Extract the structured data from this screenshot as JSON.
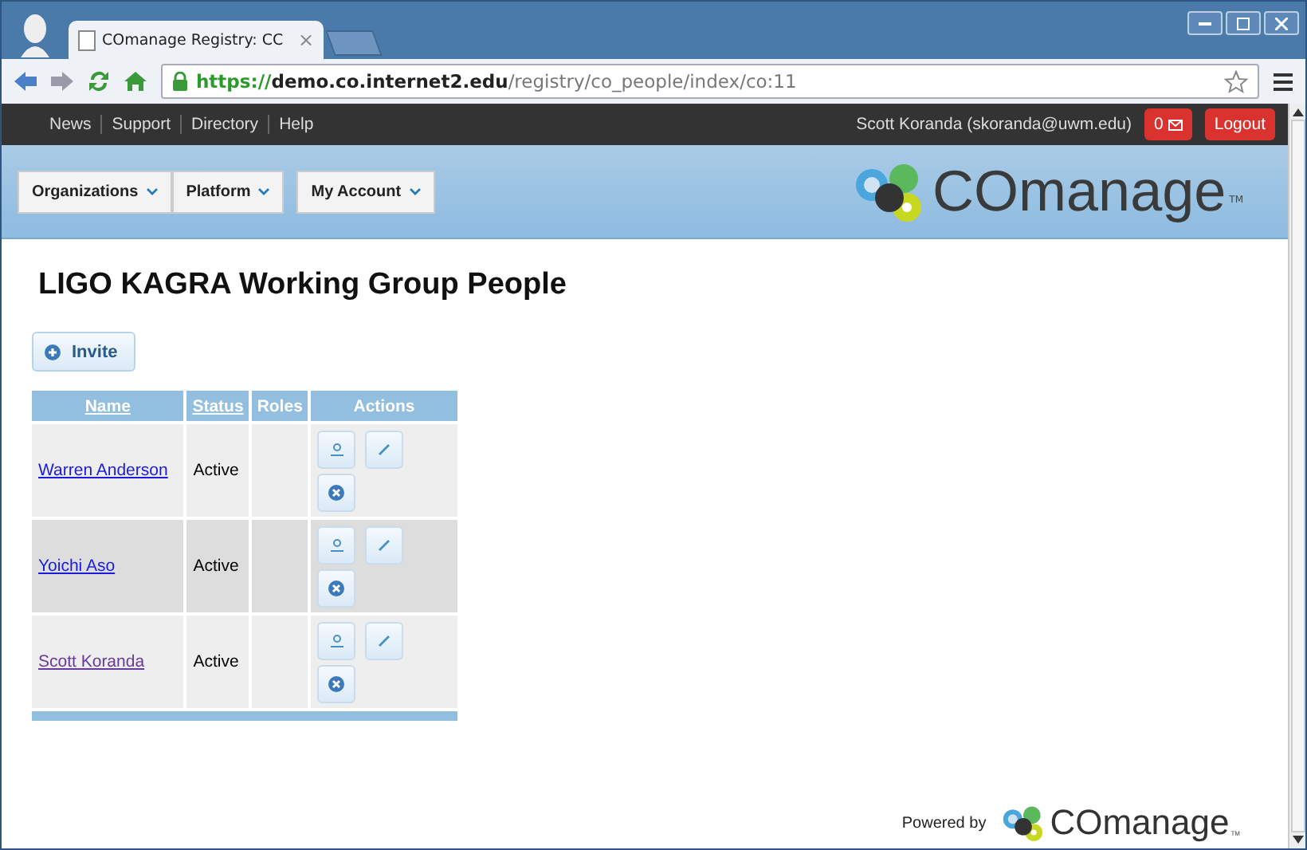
{
  "browser": {
    "tab_title": "COmanage Registry: CC",
    "tab_close": "×",
    "url_scheme": "https://",
    "url_host": "demo.co.internet2.edu",
    "url_path": "/registry/co_people/index/co:11"
  },
  "topbar": {
    "links": [
      "News",
      "Support",
      "Directory",
      "Help"
    ],
    "user": "Scott Koranda (skoranda@uwm.edu)",
    "notifications": "0",
    "logout": "Logout"
  },
  "menu": [
    "Organizations",
    "Platform",
    "My Account"
  ],
  "logo": {
    "text": "COmanage",
    "tm": "TM"
  },
  "page": {
    "title": "LIGO KAGRA Working Group People",
    "invite": "Invite"
  },
  "table": {
    "columns": [
      {
        "label": "Name",
        "sortable": true
      },
      {
        "label": "Status",
        "sortable": true
      },
      {
        "label": "Roles",
        "sortable": false
      },
      {
        "label": "Actions",
        "sortable": false
      }
    ],
    "rows": [
      {
        "name": "Warren Anderson",
        "status": "Active",
        "visited": false
      },
      {
        "name": "Yoichi Aso",
        "status": "Active",
        "visited": false
      },
      {
        "name": "Scott Koranda",
        "status": "Active",
        "visited": true
      }
    ]
  },
  "footer": {
    "powered_by": "Powered by",
    "logo": "COmanage",
    "tm": "TM"
  }
}
